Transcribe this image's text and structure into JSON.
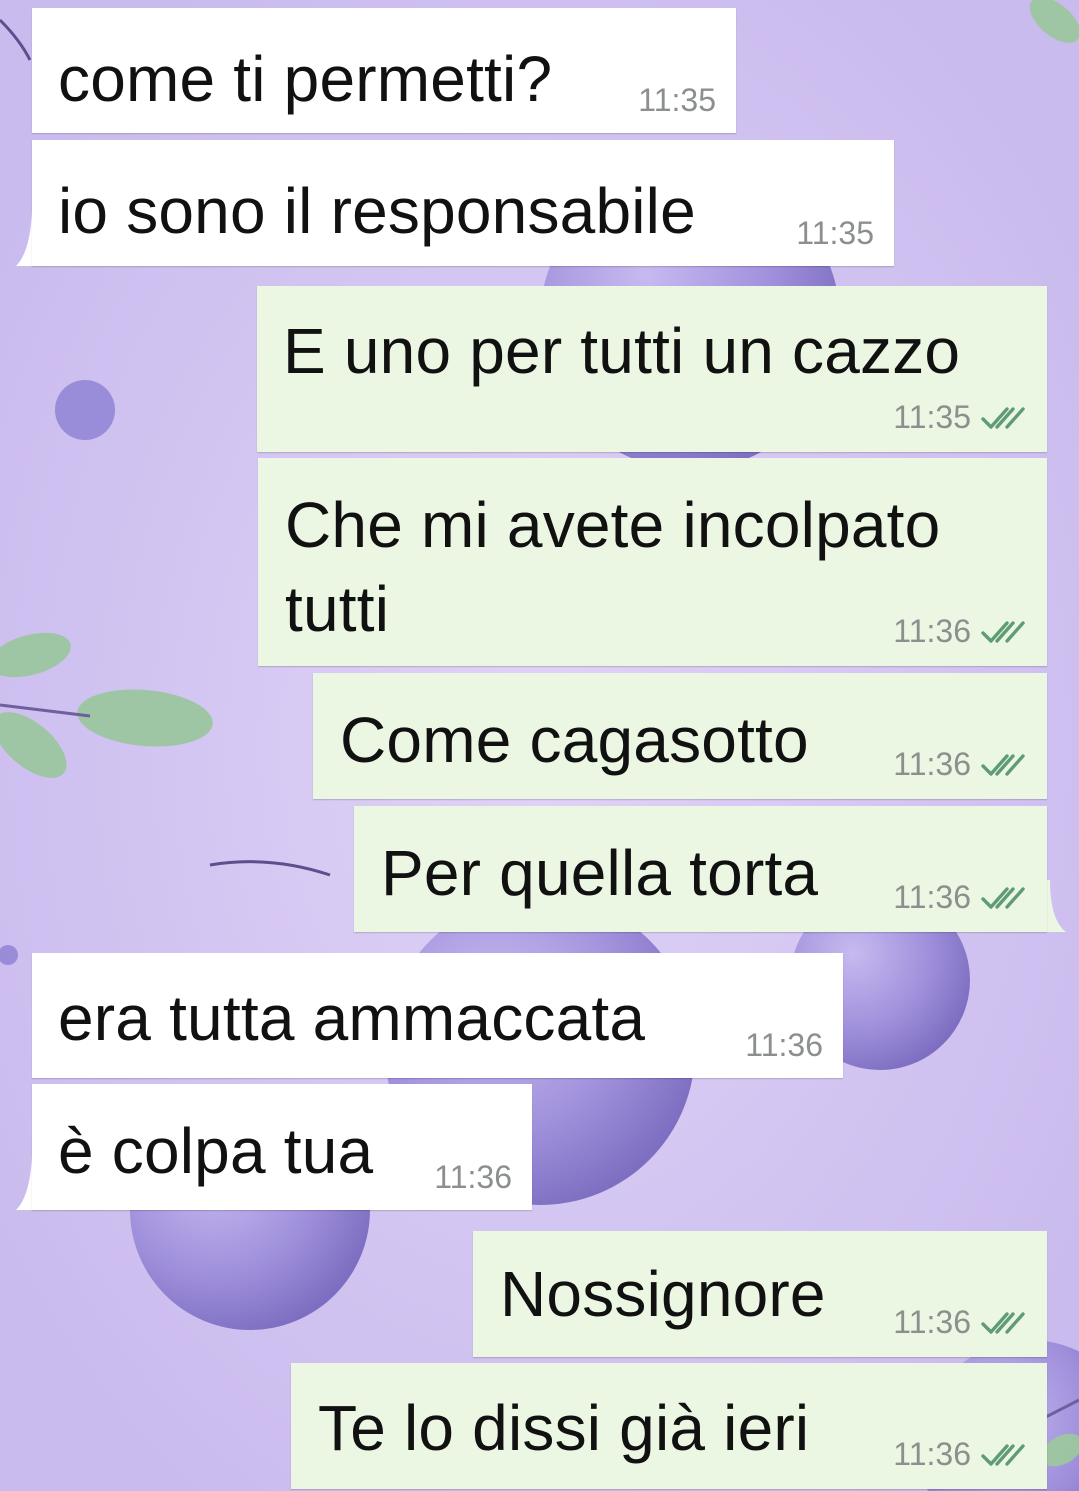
{
  "messages": [
    {
      "direction": "in",
      "text": "come ti permetti?",
      "time": "11:35"
    },
    {
      "direction": "in",
      "text": "io sono il responsabile",
      "time": "11:35"
    },
    {
      "direction": "out",
      "text": "E uno per tutti un cazzo",
      "time": "11:35",
      "status_icon": "double-check-icon"
    },
    {
      "direction": "out",
      "text_line1": "Che mi avete incolpato",
      "text_line2": "tutti",
      "time": "11:36",
      "status_icon": "double-check-icon"
    },
    {
      "direction": "out",
      "text": "Come cagasotto",
      "time": "11:36",
      "status_icon": "double-check-icon"
    },
    {
      "direction": "out",
      "text": "Per quella torta",
      "time": "11:36",
      "status_icon": "double-check-icon"
    },
    {
      "direction": "in",
      "text": "era tutta ammaccata",
      "time": "11:36"
    },
    {
      "direction": "in",
      "text": "è colpa tua",
      "time": "11:36"
    },
    {
      "direction": "out",
      "text": "Nossignore",
      "time": "11:36",
      "status_icon": "double-check-icon"
    },
    {
      "direction": "out",
      "text": "Te lo dissi già ieri",
      "time": "11:36",
      "status_icon": "double-check-icon"
    }
  ],
  "colors": {
    "incoming_bubble": "#ffffff",
    "outgoing_bubble": "#ebf7e3",
    "timestamp": "#8b8f8d",
    "check_marks": "#5f9c75",
    "wallpaper": "#d9cdf0"
  }
}
